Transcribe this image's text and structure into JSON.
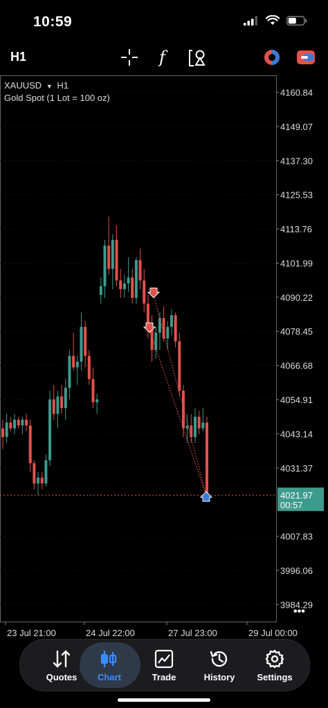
{
  "status": {
    "time": "10:59"
  },
  "toolbar": {
    "timeframe": "H1",
    "icons": [
      "crosshair-icon",
      "function-icon",
      "objects-icon",
      "indicator-color-icon",
      "account-icon"
    ]
  },
  "chart": {
    "symbol": "XAUUSD",
    "symbol_timeframe": "H1",
    "description": "Gold Spot (1 Lot = 100 oz)",
    "current_price": "4021.97",
    "countdown": "00:57",
    "more": "•••"
  },
  "chart_data": {
    "type": "candlestick",
    "title": "XAUUSD H1",
    "ylim": [
      3978.4,
      4166.7
    ],
    "y_ticks": [
      "4160.84",
      "4149.07",
      "4137.30",
      "4125.53",
      "4113.76",
      "4101.99",
      "4090.22",
      "4078.45",
      "4066.68",
      "4054.91",
      "4043.14",
      "4031.37",
      "4007.83",
      "3996.06",
      "3984.29"
    ],
    "x_ticks": [
      "23 Jul 21:00",
      "24 Jul 22:00",
      "27 Jul 23:00",
      "29 Jul 00:00"
    ],
    "current_price": 4021.97,
    "series": [
      {
        "name": "ohlc",
        "values": [
          [
            4045,
            4048,
            4038,
            4042
          ],
          [
            4042,
            4050,
            4040,
            4047
          ],
          [
            4047,
            4049,
            4044,
            4045
          ],
          [
            4045,
            4050,
            4043,
            4048
          ],
          [
            4048,
            4049,
            4045,
            4046
          ],
          [
            4046,
            4049,
            4043,
            4048
          ],
          [
            4048,
            4050,
            4044,
            4046
          ],
          [
            4046,
            4048,
            4030,
            4033
          ],
          [
            4033,
            4034,
            4024,
            4026
          ],
          [
            4026,
            4030,
            4022,
            4028
          ],
          [
            4028,
            4030,
            4024,
            4026
          ],
          [
            4026,
            4036,
            4025,
            4034
          ],
          [
            4034,
            4058,
            4032,
            4055
          ],
          [
            4055,
            4060,
            4048,
            4050
          ],
          [
            4050,
            4058,
            4045,
            4056
          ],
          [
            4056,
            4060,
            4050,
            4052
          ],
          [
            4052,
            4062,
            4048,
            4059
          ],
          [
            4059,
            4072,
            4055,
            4070
          ],
          [
            4070,
            4078,
            4065,
            4066
          ],
          [
            4066,
            4070,
            4060,
            4068
          ],
          [
            4068,
            4085,
            4065,
            4080
          ],
          [
            4080,
            4082,
            4066,
            4070
          ],
          [
            4070,
            4072,
            4060,
            4062
          ],
          [
            4062,
            4066,
            4052,
            4054
          ],
          [
            4054,
            4057,
            4050,
            4055
          ],
          [
            4091,
            4097,
            4088,
            4094
          ],
          [
            4094,
            4110,
            4090,
            4108
          ],
          [
            4108,
            4118,
            4098,
            4100
          ],
          [
            4100,
            4112,
            4093,
            4110
          ],
          [
            4110,
            4115,
            4094,
            4096
          ],
          [
            4096,
            4100,
            4090,
            4093
          ],
          [
            4093,
            4098,
            4090,
            4095
          ],
          [
            4095,
            4104,
            4092,
            4097
          ],
          [
            4097,
            4100,
            4088,
            4090
          ],
          [
            4090,
            4104,
            4088,
            4103
          ],
          [
            4103,
            4107,
            4093,
            4096
          ],
          [
            4096,
            4100,
            4085,
            4088
          ],
          [
            4088,
            4091,
            4076,
            4080
          ],
          [
            4080,
            4084,
            4068,
            4072
          ],
          [
            4072,
            4080,
            4069,
            4078
          ],
          [
            4078,
            4085,
            4072,
            4083
          ],
          [
            4083,
            4087,
            4075,
            4076
          ],
          [
            4076,
            4082,
            4072,
            4080
          ],
          [
            4080,
            4086,
            4077,
            4084
          ],
          [
            4084,
            4085,
            4073,
            4075
          ],
          [
            4075,
            4078,
            4056,
            4058
          ],
          [
            4058,
            4060,
            4042,
            4045
          ],
          [
            4045,
            4050,
            4040,
            4046
          ],
          [
            4046,
            4050,
            4040,
            4042
          ],
          [
            4042,
            4052,
            4040,
            4049
          ],
          [
            4049,
            4051,
            4043,
            4045
          ],
          [
            4045,
            4052,
            4044,
            4047
          ],
          [
            4047,
            4049,
            4021,
            4022
          ]
        ]
      }
    ],
    "trades": [
      {
        "type": "sell",
        "price": 4091
      },
      {
        "type": "sell",
        "price": 4079
      },
      {
        "type": "buy",
        "price": 4022
      }
    ],
    "colors": {
      "up": "#3d9b8c",
      "down": "#e0524c",
      "bg": "#000000",
      "grid": "#2a2a2a",
      "price_line": "#e0524c",
      "price_tag": "#3d9b8c"
    }
  },
  "tabs": [
    {
      "label": "Quotes",
      "icon": "quotes-icon"
    },
    {
      "label": "Chart",
      "icon": "chart-icon"
    },
    {
      "label": "Trade",
      "icon": "trade-icon"
    },
    {
      "label": "History",
      "icon": "history-icon"
    },
    {
      "label": "Settings",
      "icon": "settings-icon"
    }
  ],
  "active_tab": "Chart"
}
